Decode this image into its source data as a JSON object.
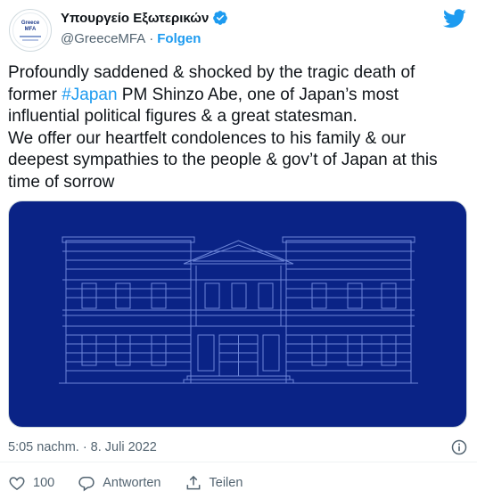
{
  "account": {
    "display_name": "Υπουργείο Εξωτερικών",
    "handle": "@GreeceMFA",
    "separator": "·",
    "follow_label": "Folgen",
    "avatar_line1": "Greece",
    "avatar_line2": "MFA"
  },
  "tweet": {
    "text_before": "Profoundly saddened & shocked by the tragic death of former ",
    "hashtag": "#Japan",
    "text_after": " PM Shinzo Abe, one of Japan’s most influential political figures & a great statesman.",
    "text_line2": "We offer our heartfelt condolences to his family & our deepest sympathies to the people & gov’t of Japan at this time of sorrow"
  },
  "meta": {
    "timestamp": "5:05 nachm. · 8. Juli 2022"
  },
  "actions": {
    "like_count": "100",
    "reply_label": "Antworten",
    "share_label": "Teilen"
  },
  "colors": {
    "accent": "#1d9bf0",
    "media_bg": "#0a2386",
    "blueprint_line": "#6d86d8"
  }
}
